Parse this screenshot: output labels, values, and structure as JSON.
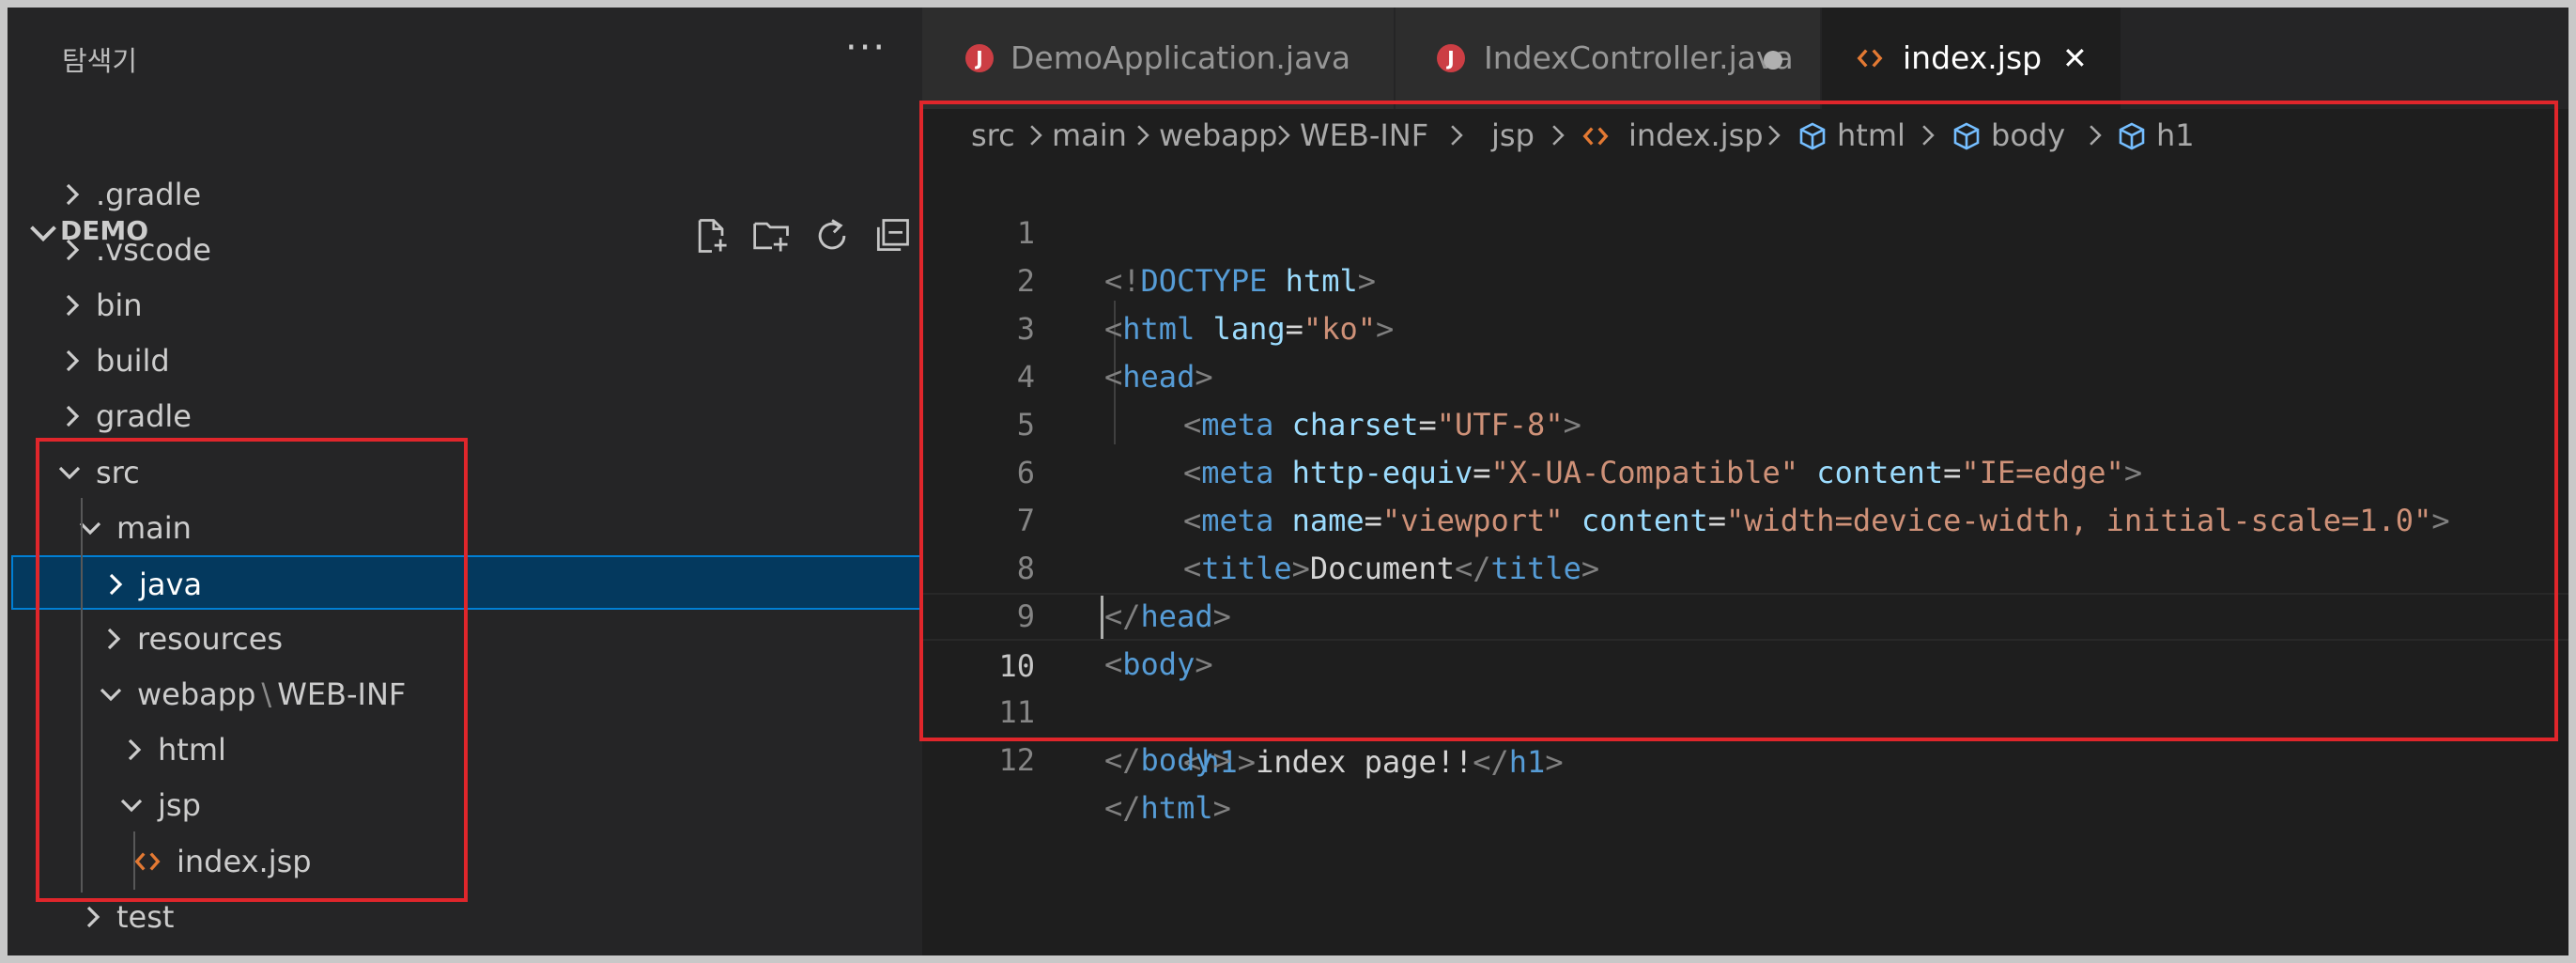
{
  "explorer": {
    "title": "탐색기",
    "more": "···",
    "section_title": "DEMO",
    "actions": [
      "new-file-icon",
      "new-folder-icon",
      "refresh-icon",
      "collapse-all-icon"
    ],
    "tree": [
      {
        "label": ".gradle",
        "expanded": false
      },
      {
        "label": ".vscode",
        "expanded": false
      },
      {
        "label": "bin",
        "expanded": false
      },
      {
        "label": "build",
        "expanded": false
      },
      {
        "label": "gradle",
        "expanded": false
      },
      {
        "label": "src",
        "expanded": true
      },
      {
        "label": "main",
        "expanded": true
      },
      {
        "label": "java",
        "expanded": false,
        "selected": true
      },
      {
        "label": "resources",
        "expanded": false
      },
      {
        "label": "webapp",
        "label2": "WEB-INF",
        "separator": "\\",
        "expanded": true
      },
      {
        "label": "html",
        "expanded": false
      },
      {
        "label": "jsp",
        "expanded": true
      },
      {
        "label": "index.jsp",
        "file": true
      },
      {
        "label": "test",
        "expanded": false
      }
    ]
  },
  "tabs": [
    {
      "label": "DemoApplication.java",
      "icon": "J",
      "active": false,
      "dirty": false
    },
    {
      "label": "IndexController.java",
      "icon": "J",
      "active": false,
      "dirty": true
    },
    {
      "label": "index.jsp",
      "icon": "<>",
      "active": true,
      "close": "✕"
    }
  ],
  "breadcrumb": [
    "src",
    "main",
    "webapp",
    "WEB-INF",
    "jsp",
    "index.jsp",
    "html",
    "body",
    "h1"
  ],
  "code": {
    "current_line": 10,
    "lines": [
      {
        "n": "1"
      },
      {
        "n": "2"
      },
      {
        "n": "3"
      },
      {
        "n": "4"
      },
      {
        "n": "5"
      },
      {
        "n": "6"
      },
      {
        "n": "7"
      },
      {
        "n": "8"
      },
      {
        "n": "9"
      },
      {
        "n": "10"
      },
      {
        "n": "11"
      },
      {
        "n": "12"
      }
    ],
    "tokens": {
      "l1": [
        "<!",
        "DOCTYPE",
        " html",
        ">"
      ],
      "l2": [
        "<",
        "html",
        " lang",
        "=",
        "\"ko\"",
        ">"
      ],
      "l3": [
        "<",
        "head",
        ">"
      ],
      "l4": [
        "<",
        "meta",
        " charset",
        "=",
        "\"UTF-8\"",
        ">"
      ],
      "l5": [
        "<",
        "meta",
        " http-equiv",
        "=",
        "\"X-UA-Compatible\"",
        " content",
        "=",
        "\"IE=edge\"",
        ">"
      ],
      "l6": [
        "<",
        "meta",
        " name",
        "=",
        "\"viewport\"",
        " content",
        "=",
        "\"width=device-width, initial-scale=1.0\"",
        ">"
      ],
      "l7": [
        "<",
        "title",
        ">",
        "Document",
        "</",
        "title",
        ">"
      ],
      "l8": [
        "</",
        "head",
        ">"
      ],
      "l9": [
        "<",
        "body",
        ">"
      ],
      "l10": [
        "<",
        "h1",
        ">",
        "index page!!",
        "</",
        "h1",
        ">"
      ],
      "l11": [
        "</",
        "body",
        ">"
      ],
      "l12": [
        "</",
        "html",
        ">"
      ]
    }
  },
  "colors": {
    "highlight_box": "#e0262b",
    "selection": "#04395e",
    "tag": "#569cd6",
    "attribute": "#9cdcfe",
    "string": "#ce9178"
  }
}
